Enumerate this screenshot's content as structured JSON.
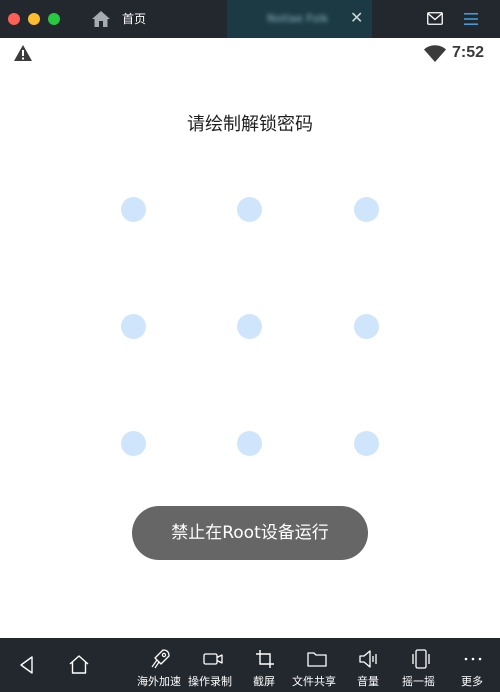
{
  "titlebar": {
    "home_tab_label": "首页",
    "app_tab_label": "Notlae Folk",
    "tab_close": "✕"
  },
  "statusbar": {
    "time": "7:52"
  },
  "lock": {
    "title": "请绘制解锁密码",
    "toast": "禁止在Root设备运行",
    "dot_color": "#cfe5fb"
  },
  "toolbar": {
    "items": [
      {
        "label": "海外加速",
        "icon": "rocket-icon"
      },
      {
        "label": "操作录制",
        "icon": "video-record-icon"
      },
      {
        "label": "截屏",
        "icon": "crop-icon"
      },
      {
        "label": "文件共享",
        "icon": "folder-icon"
      },
      {
        "label": "音量",
        "icon": "volume-icon"
      },
      {
        "label": "摇一摇",
        "icon": "shake-phone-icon"
      },
      {
        "label": "更多",
        "icon": "more-icon"
      }
    ]
  },
  "colors": {
    "chrome": "#23272e",
    "active_tab": "#1c3a44",
    "toast": "#666666"
  }
}
